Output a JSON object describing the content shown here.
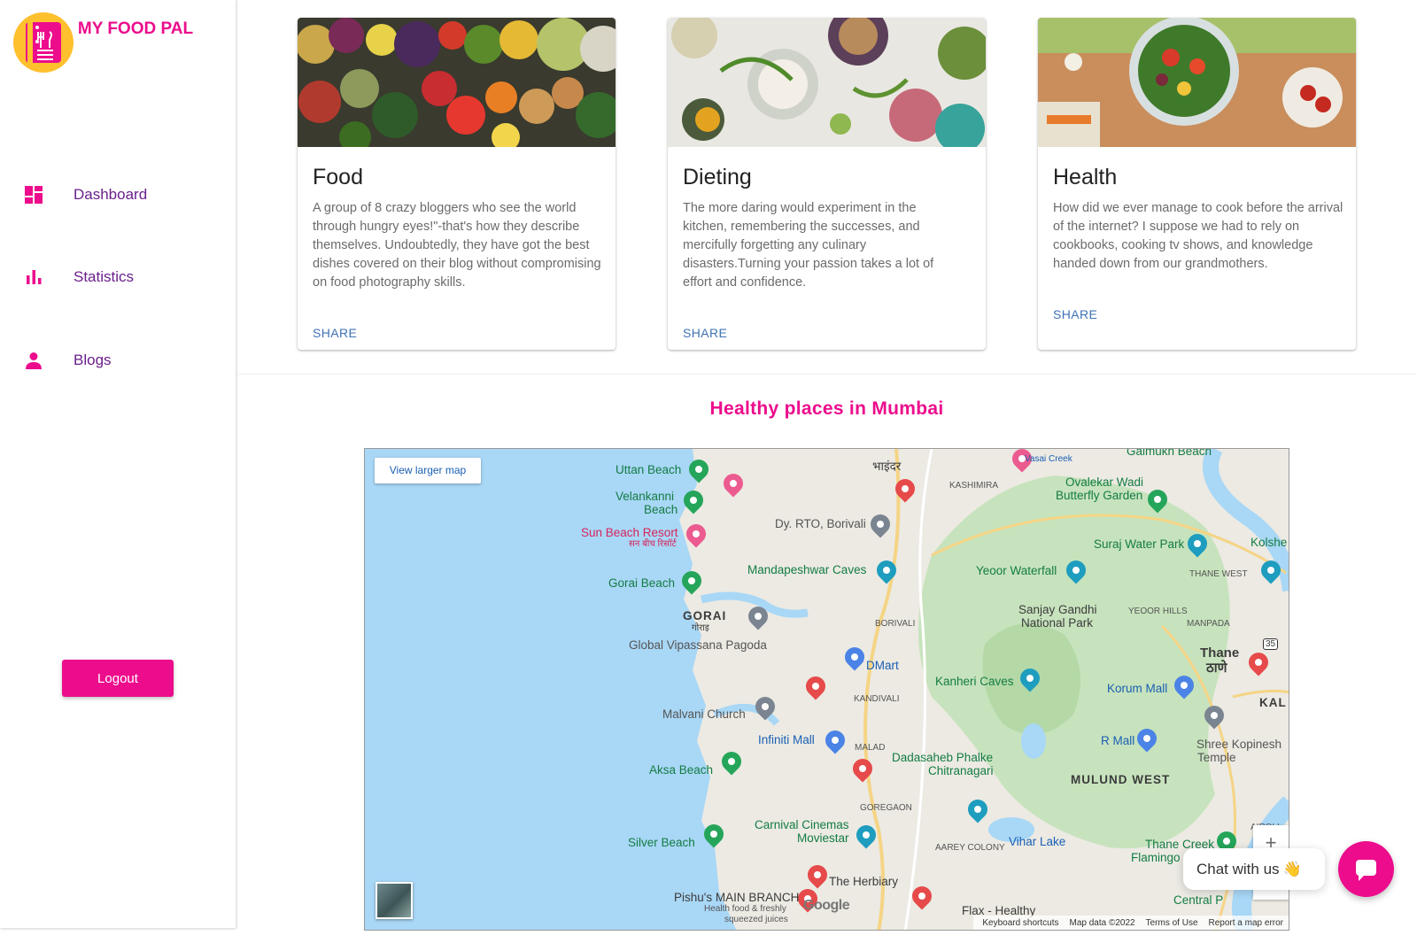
{
  "brand": {
    "title": "MY FOOD PAL"
  },
  "sidebar": {
    "items": [
      {
        "label": "Dashboard",
        "icon": "dashboard-icon"
      },
      {
        "label": "Statistics",
        "icon": "bar-chart-icon"
      },
      {
        "label": "Blogs",
        "icon": "person-icon"
      }
    ],
    "logout_label": "Logout"
  },
  "cards": [
    {
      "title": "Food",
      "text": "A group of 8 crazy bloggers who see the world through hungry eyes!\"-that's how they describe themselves. Undoubtedly, they have got the best dishes covered on their blog without compromising on food photography skills.",
      "action": "SHARE"
    },
    {
      "title": "Dieting",
      "text": "The more daring would experiment in the kitchen, remembering the successes, and mercifully forgetting any culinary disasters.Turning your passion takes a lot of effort and confidence.",
      "action": "SHARE"
    },
    {
      "title": "Health",
      "text": "How did we ever manage to cook before the arrival of the internet? I suppose we had to rely on cookbooks, cooking tv shows, and knowledge handed down from our grandmothers.",
      "action": "SHARE"
    }
  ],
  "section_title": "Healthy places in Mumbai",
  "map": {
    "view_larger": "View larger map",
    "zoom_in": "+",
    "zoom_out": "−",
    "google": "Google",
    "footer": {
      "shortcuts": "Keyboard shortcuts",
      "map_data": "Map data ©2022",
      "terms": "Terms of Use",
      "report": "Report a map error"
    },
    "labels": {
      "uttan": "Uttan Beach",
      "velankanni1": "Velankanni",
      "velankanni2": "Beach",
      "sun_beach": "Sun Beach Resort",
      "sun_beach_hi": "सन बीच रिसॉर्ट",
      "gorai_beach": "Gorai Beach",
      "gorai": "GORAI",
      "gorai_hi": "गोराइ",
      "vipassana": "Global Vipassana Pagoda",
      "malvani": "Malvani Church",
      "aksa": "Aksa Beach",
      "silver": "Silver Beach",
      "rto": "Dy. RTO, Borivali",
      "mandapeshwar": "Mandapeshwar Caves",
      "dmart": "DMart",
      "kandivali": "KANDIVALI",
      "borivali": "BORIVALI",
      "infiniti": "Infiniti Mall",
      "malad": "MALAD",
      "goregaon": "GOREGAON",
      "carnival1": "Carnival Cinemas",
      "carnival2": "Moviestar",
      "herbiary": "The Herbiary",
      "pishu": "Pishu's MAIN BRANCH",
      "pishu2": "Health food & freshly",
      "pishu3": "squeezed juices",
      "flax": "Flax - Healthy",
      "bhayandar": "भाइंदर",
      "kashimira": "KASHIMIRA",
      "ovalekar1": "Ovalekar Wadi",
      "ovalekar2": "Butterfly Garden",
      "suraj": "Suraj Water Park",
      "yeoor": "Yeoor Waterfall",
      "sgnp1": "Sanjay Gandhi",
      "sgnp2": "National Park",
      "yeoor_hills": "YEOOR HILLS",
      "thane_west": "THANE WEST",
      "manpada": "MANPADA",
      "thane": "Thane",
      "thane_hi": "ठाणे",
      "kanheri": "Kanheri Caves",
      "korum": "Korum Mall",
      "kal": "KAL",
      "rmall": "R Mall",
      "kopinesh1": "Shree Kopinesh",
      "kopinesh2": "Temple",
      "dadasaheb1": "Dadasaheb Phalke",
      "dadasaheb2": "Chitranagari",
      "mulund": "MULUND WEST",
      "aarey": "AAREY COLONY",
      "vihar": "Vihar Lake",
      "thane_creek": "Thane Creek",
      "flamingo": "Flamingo San",
      "central": "Central P",
      "airoli": "AIROLI",
      "kolshe": "Kolshe",
      "vasai_creek": "Vasai Creek",
      "gaimukh": "Gaimukh Beach",
      "nh": "35"
    }
  },
  "chat": {
    "label": "Chat with us",
    "emoji": "👋"
  },
  "colors": {
    "accent": "#ec0c8c",
    "nav_text": "#6a1f8c",
    "link": "#3f73b5",
    "logo_bg": "#ffc02e"
  }
}
